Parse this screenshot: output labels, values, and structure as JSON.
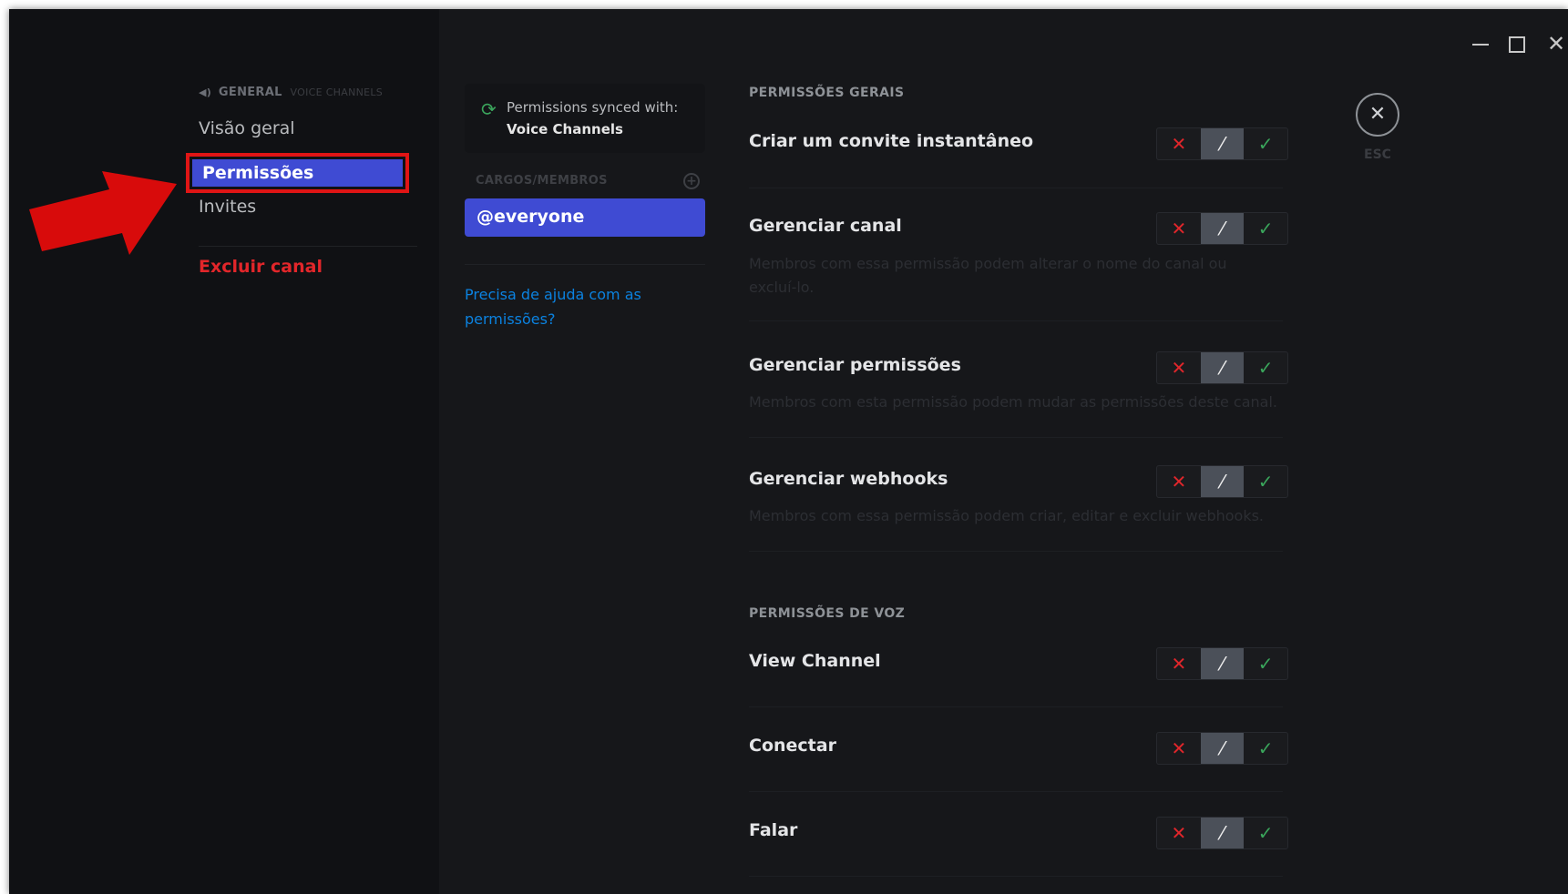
{
  "sidebar": {
    "header": "GENERAL",
    "header_sub": "VOICE CHANNELS",
    "items": [
      {
        "label": "Visão geral"
      },
      {
        "label": "Permissões"
      },
      {
        "label": "Invites"
      }
    ],
    "delete_label": "Excluir canal"
  },
  "sync": {
    "line1": "Permissions synced with:",
    "line2": "Voice Channels"
  },
  "roles": {
    "header": "CARGOS/MEMBROS",
    "selected": "@everyone",
    "help": "Precisa de ajuda com as permissões?"
  },
  "sections": {
    "general_title": "PERMISSÕES GERAIS",
    "voice_title": "PERMISSÕES DE VOZ"
  },
  "permissions": {
    "invite": {
      "name": "Criar um convite instantâneo"
    },
    "manage_channel": {
      "name": "Gerenciar canal",
      "desc": "Membros com essa permissão podem alterar o nome do canal ou excluí-lo."
    },
    "manage_perms": {
      "name": "Gerenciar permissões",
      "desc": "Membros com esta permissão podem mudar as permissões deste canal."
    },
    "webhooks": {
      "name": "Gerenciar webhooks",
      "desc": "Membros com essa permissão podem criar, editar e excluir webhooks."
    },
    "view_channel": {
      "name": "View Channel"
    },
    "connect": {
      "name": "Conectar"
    },
    "speak": {
      "name": "Falar"
    }
  },
  "toggle": {
    "deny": "✕",
    "neutral": "⁄",
    "allow": "✓",
    "state": "neutral"
  },
  "close": {
    "icon": "✕",
    "label": "ESC"
  },
  "window": {
    "close_icon": "✕"
  },
  "colors": {
    "accent": "#3f4bd3",
    "danger": "#e2262a",
    "success": "#3aa55b",
    "link": "#0b82e0"
  }
}
